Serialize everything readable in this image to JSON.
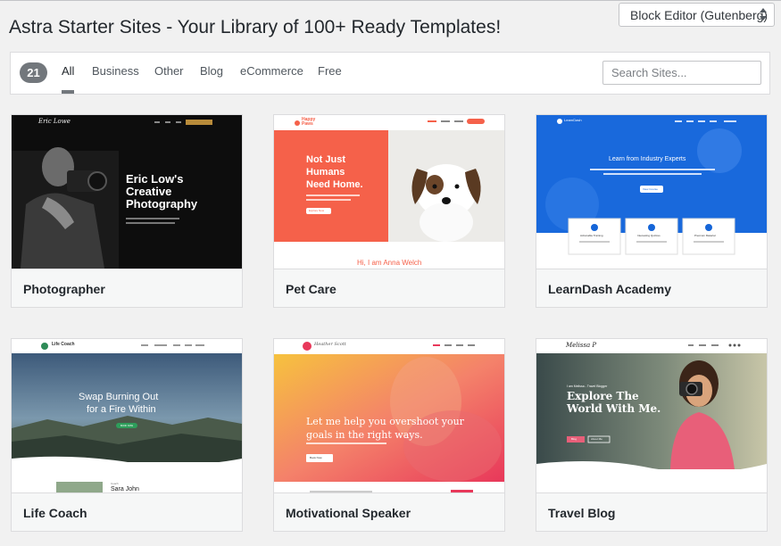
{
  "header": {
    "title": "Astra Starter Sites - Your Library of 100+ Ready Templates!",
    "editor_select": "Block Editor (Gutenberg)"
  },
  "filters": {
    "count": "21",
    "tabs": [
      "All",
      "Business",
      "Other",
      "Blog",
      "eCommerce",
      "Free"
    ],
    "active_tab": "All",
    "search_placeholder": "Search Sites..."
  },
  "sites": [
    {
      "name": "Photographer",
      "preview": {
        "logo": "Eric Lowe",
        "heading_lines": [
          "Eric Low's",
          "Creative",
          "Photography"
        ]
      }
    },
    {
      "name": "Pet Care",
      "preview": {
        "logo_lines": [
          "Happy",
          "Paws"
        ],
        "heading_lines": [
          "Not Just",
          "Humans",
          "Need Home."
        ],
        "button": "Explore Now",
        "subheading": "Hi, I am Anna Welch"
      }
    },
    {
      "name": "LearnDash Academy",
      "preview": {
        "logo": "LearnDash",
        "heading": "Learn from Industry Experts",
        "button": "View Course",
        "features": [
          "Actionable Training",
          "Interesting Quizzes",
          "Premium Material"
        ]
      }
    },
    {
      "name": "Life Coach",
      "preview": {
        "logo": "Life Coach",
        "heading_lines": [
          "Swap Burning Out",
          "for a Fire Within"
        ],
        "button": "BOOK NOW",
        "person_role": "Coach",
        "person_name": "Sara John"
      }
    },
    {
      "name": "Motivational Speaker",
      "preview": {
        "logo": "Heather Scott",
        "heading_lines": [
          "Let me help you overshoot your",
          "goals in the right ways."
        ],
        "button": "Book Now"
      }
    },
    {
      "name": "Travel Blog",
      "preview": {
        "logo": "Melissa P",
        "tagline": "I am Melissa - Travel Blogger",
        "heading_lines": [
          "Explore The",
          "World With Me."
        ],
        "buttons": [
          "Blog",
          "About Me"
        ]
      }
    }
  ]
}
